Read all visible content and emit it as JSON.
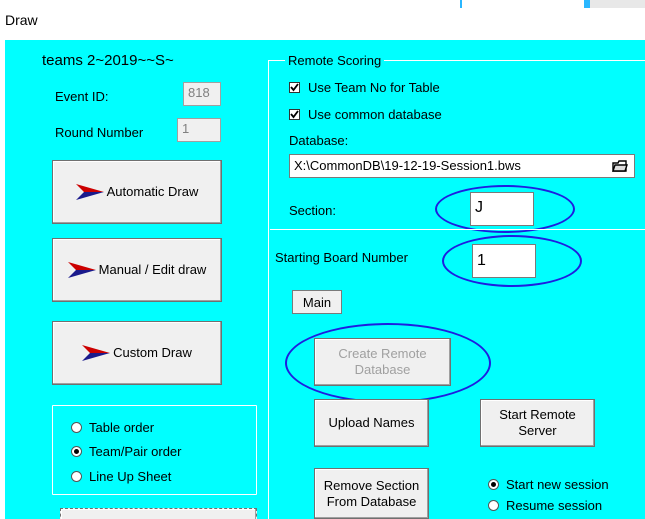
{
  "window": {
    "title": "Draw"
  },
  "left": {
    "team_title": "teams 2~2019~~S~",
    "event_id": {
      "label": "Event ID:",
      "value": "818"
    },
    "round_number": {
      "label": "Round Number",
      "value": "1"
    },
    "buttons": {
      "automatic": "Automatic Draw",
      "manual": "Manual / Edit draw",
      "custom": "Custom Draw"
    },
    "order_options": [
      {
        "label": "Table order",
        "selected": false
      },
      {
        "label": "Team/Pair order",
        "selected": true
      },
      {
        "label": "Line Up Sheet",
        "selected": false
      }
    ]
  },
  "remote": {
    "legend": "Remote Scoring",
    "use_team_no": {
      "label": "Use Team No for Table",
      "checked": true
    },
    "use_common_db": {
      "label": "Use common database",
      "checked": true
    },
    "database_label": "Database:",
    "database_path": "X:\\CommonDB\\19-12-19-Session1.bws",
    "section_label": "Section:",
    "section_value": "J",
    "starting_board_label": "Starting Board Number",
    "starting_board_value": "1",
    "main_label": "Main",
    "create_db_button": "Create Remote Database",
    "upload_names_button": "Upload Names",
    "start_server_button": "Start Remote Server",
    "remove_section_button": "Remove Section From Database",
    "session_options": [
      {
        "label": "Start new session",
        "selected": true
      },
      {
        "label": "Resume session",
        "selected": false
      }
    ]
  },
  "colors": {
    "panel": "#00ffff",
    "highlight_ellipse": "#1e1ee0",
    "arrow_red": "#cc0000",
    "arrow_blue": "#1a1a8c"
  }
}
